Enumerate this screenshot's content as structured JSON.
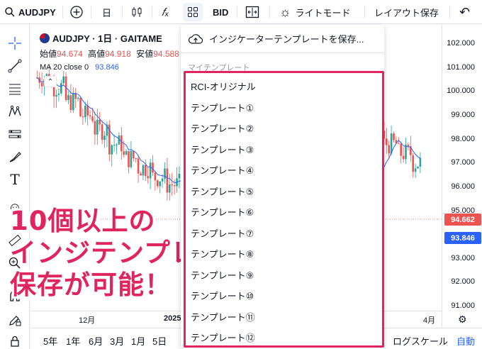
{
  "toolbar": {
    "symbol": "AUDJPY",
    "interval": "日",
    "bid": "BID",
    "theme": "ライトモード",
    "save_layout": "レイアウト保存"
  },
  "legend": {
    "title": "AUDJPY · 1日 · GAITAME",
    "open_label": "始値",
    "open_value": "94.674",
    "high_label": "高値",
    "high_value": "94.918",
    "low_label": "安値",
    "low_value": "94.588",
    "ma_label": "MA 20 close 0",
    "ma_value": "93.846"
  },
  "price_scale": {
    "ticks": [
      "102.000",
      "101.000",
      "100.000",
      "99.000",
      "98.000",
      "97.000",
      "96.000",
      "95.000",
      "93.000",
      "92.000",
      "91.000"
    ],
    "last_price": "94.662",
    "ma_price": "93.846"
  },
  "time_axis": {
    "ticks": [
      "12月",
      "2025",
      "4月"
    ]
  },
  "bottom": {
    "ranges": [
      "5年",
      "1年",
      "6月",
      "3月",
      "1月",
      "5日"
    ],
    "log_scale": "ログスケール",
    "auto": "自動"
  },
  "promo": {
    "line1": "10個以上の",
    "line2": "インジテンプレ",
    "line3": "保存が可能！"
  },
  "dropdown": {
    "save_label": "インジケーターテンプレートを保存...",
    "section": "マイテンプレート",
    "items": [
      "RCI-オリジナル",
      "テンプレート①",
      "テンプレート②",
      "テンプレート③",
      "テンプレート④",
      "テンプレート⑤",
      "テンプレート⑥",
      "テンプレート⑦",
      "テンプレート⑧",
      "テンプレート⑨",
      "テンプレート⑩",
      "テンプレート⑪",
      "テンプレート⑫"
    ]
  },
  "colors": {
    "up": "#26a69a",
    "down": "#ef5350",
    "ma": "#2962ff",
    "highlight": "#e0245e"
  }
}
